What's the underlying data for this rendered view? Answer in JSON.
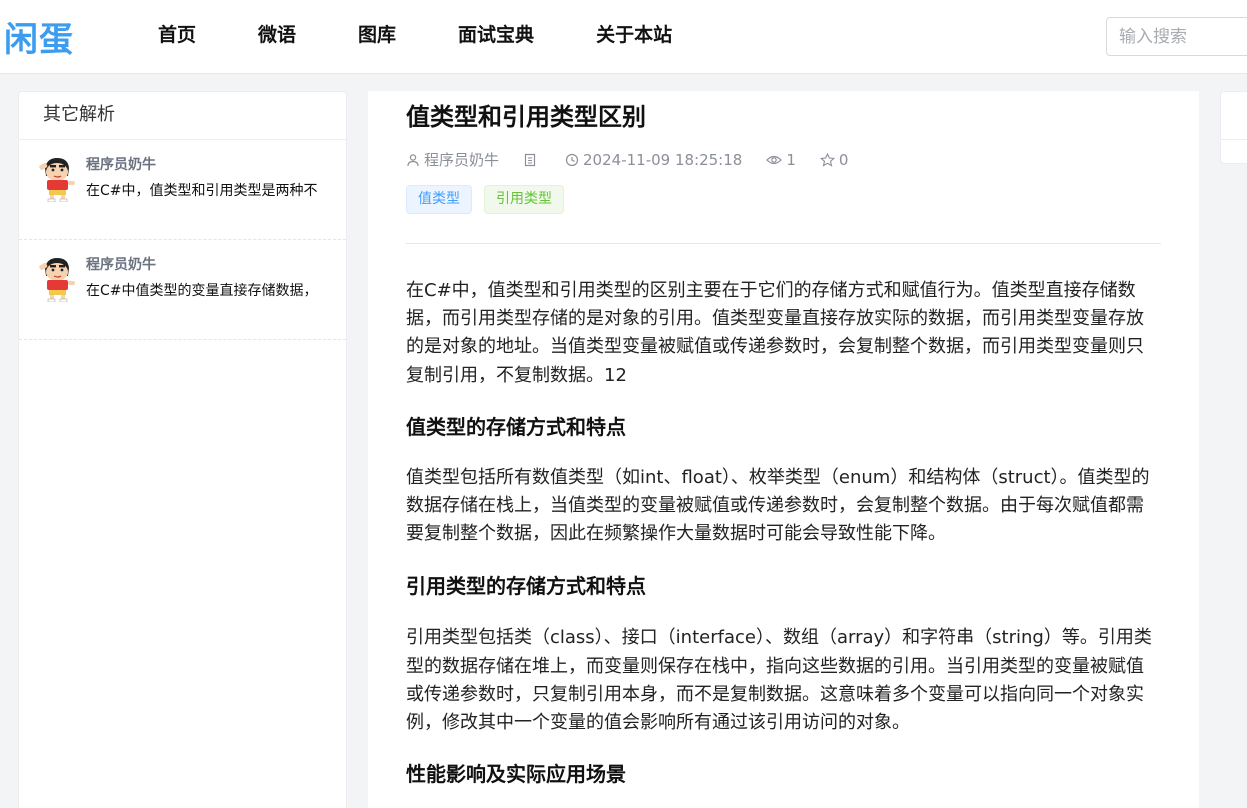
{
  "header": {
    "logo": "闲蛋",
    "nav": [
      "首页",
      "微语",
      "图库",
      "面试宝典",
      "关于本站"
    ],
    "search_placeholder": "输入搜索"
  },
  "sidebar": {
    "title": "其它解析",
    "items": [
      {
        "author": "程序员奶牛",
        "text": "在C#中，值类型和引用类型是两种不"
      },
      {
        "author": "程序员奶牛",
        "text": "在C#中值类型的变量直接存储数据，"
      }
    ]
  },
  "article": {
    "title": "值类型和引用类型区别",
    "author": "程序员奶牛",
    "datetime": "2024-11-09 18:25:18",
    "views": "1",
    "stars": "0",
    "tags": [
      "值类型",
      "引用类型"
    ],
    "paragraph1": "在C#中，值类型和引用类型的区别主要在于它们的存储方式和赋值行为。值类型直接存储数据，而引用类型存储的是对象的引用。值类型变量直接存放实际的数据，而引用类型变量存放的是对象的地址。当值类型变量被赋值或传递参数时，会复制整个数据，而引用类型变量则只复制引用，不复制数据。12",
    "heading1": "值类型的存储方式和特点",
    "paragraph2": "值类型包括所有数值类型（如int、float）、枚举类型（enum）和结构体（struct）。值类型的数据存储在栈上，当值类型的变量被赋值或传递参数时，会复制整个数据。由于每次赋值都需要复制整个数据，因此在频繁操作大量数据时可能会导致性能下降。",
    "heading2": "引用类型的存储方式和特点",
    "paragraph3": "引用类型包括类（class）、接口（interface）、数组（array）和字符串（string）等。引用类型的数据存储在堆上，而变量则保存在栈中，指向这些数据的引用。当引用类型的变量被赋值或传递参数时，只复制引用本身，而不是复制数据。这意味着多个变量可以指向同一个对象实例，修改其中一个变量的值会影响所有通过该引用访问的对象。",
    "heading3": "性能影响及实际应用场景"
  },
  "colors": {
    "accent": "#3b9cf0",
    "tag_blue": "#409eff",
    "tag_green": "#67c23a"
  }
}
